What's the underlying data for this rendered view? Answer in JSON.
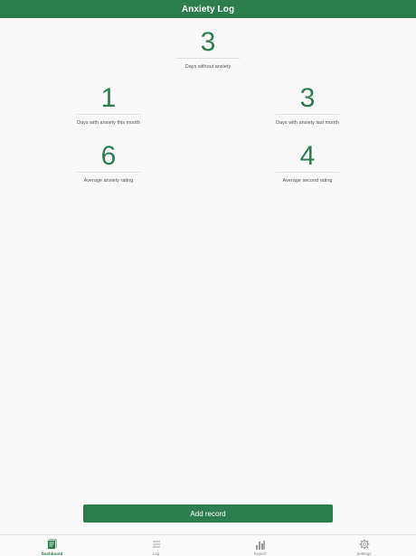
{
  "header": {
    "title": "Anxiety Log"
  },
  "stats": {
    "days_without": {
      "value": "3",
      "label": "Days without anxiety"
    },
    "this_month": {
      "value": "1",
      "label": "Days with anxiety this month"
    },
    "last_month": {
      "value": "3",
      "label": "Days with anxiety last month"
    },
    "avg_rating": {
      "value": "6",
      "label": "Average anxiety rating"
    },
    "avg_second": {
      "value": "4",
      "label": "Average second rating"
    }
  },
  "actions": {
    "add_record": "Add record"
  },
  "tabbar": {
    "items": [
      {
        "label": "Dashboard",
        "icon": "dashboard-icon",
        "active": true
      },
      {
        "label": "Log",
        "icon": "list-icon",
        "active": false
      },
      {
        "label": "Report",
        "icon": "bar-chart-icon",
        "active": false
      },
      {
        "label": "Settings",
        "icon": "gear-icon",
        "active": false
      }
    ]
  },
  "colors": {
    "primary": "#2e7d4f",
    "inactive": "#9a9a9a"
  }
}
